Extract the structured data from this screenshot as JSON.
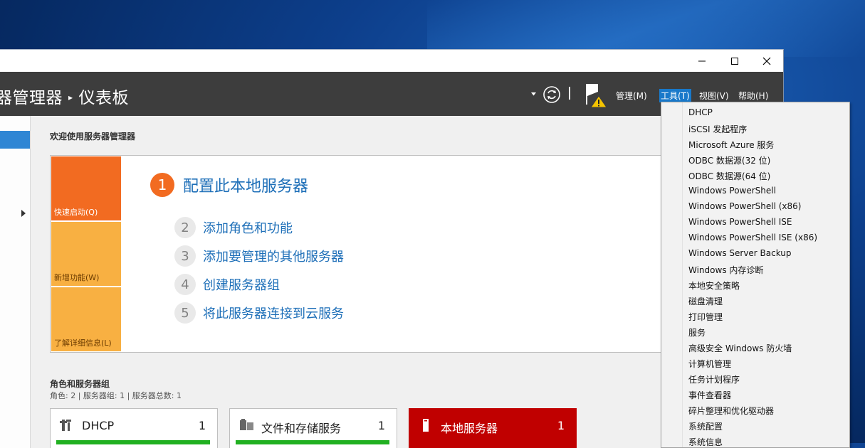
{
  "window": {
    "controls": {
      "minimize": "─",
      "maximize": "☐",
      "close": "✕"
    }
  },
  "header": {
    "breadcrumb_parent": "器管理器",
    "breadcrumb_sep": "▸",
    "breadcrumb_current": "仪表板",
    "menus": [
      "管理(M)",
      "工具(T)",
      "视图(V)",
      "帮助(H)"
    ],
    "active_menu": "工具(T)"
  },
  "welcome": {
    "title": "欢迎使用服务器管理器",
    "tiles": [
      "快速启动(Q)",
      "新增功能(W)",
      "了解详细信息(L)"
    ],
    "main_step": {
      "num": "1",
      "text": "配置此本地服务器"
    },
    "steps": [
      {
        "num": "2",
        "text": "添加角色和功能"
      },
      {
        "num": "3",
        "text": "添加要管理的其他服务器"
      },
      {
        "num": "4",
        "text": "创建服务器组"
      },
      {
        "num": "5",
        "text": "将此服务器连接到云服务"
      }
    ]
  },
  "roles": {
    "title": "角色和服务器组",
    "subtitle": "角色: 2 | 服务器组: 1 | 服务器总数: 1",
    "cards": [
      {
        "name": "DHCP",
        "count": "1",
        "icon": "dhcp-icon"
      },
      {
        "name": "文件和存储服务",
        "count": "1",
        "icon": "file-storage-icon"
      },
      {
        "name": "本地服务器",
        "count": "1",
        "icon": "local-server-icon"
      }
    ]
  },
  "tools_menu": {
    "items": [
      "DHCP",
      "iSCSI 发起程序",
      "Microsoft Azure 服务",
      "ODBC 数据源(32 位)",
      "ODBC 数据源(64 位)",
      "Windows PowerShell",
      "Windows PowerShell (x86)",
      "Windows PowerShell ISE",
      "Windows PowerShell ISE (x86)",
      "Windows Server Backup",
      "Windows 内存诊断",
      "本地安全策略",
      "磁盘清理",
      "打印管理",
      "服务",
      "高级安全 Windows 防火墙",
      "计算机管理",
      "任务计划程序",
      "事件查看器",
      "碎片整理和优化驱动器",
      "系统配置",
      "系统信息"
    ]
  },
  "colors": {
    "accent": "#1979ca",
    "header_bg": "#3d3d3d",
    "orange": "#f26b21",
    "tile_light": "#f8b042",
    "status_green": "#21b021",
    "local_server_red": "#c00000"
  }
}
